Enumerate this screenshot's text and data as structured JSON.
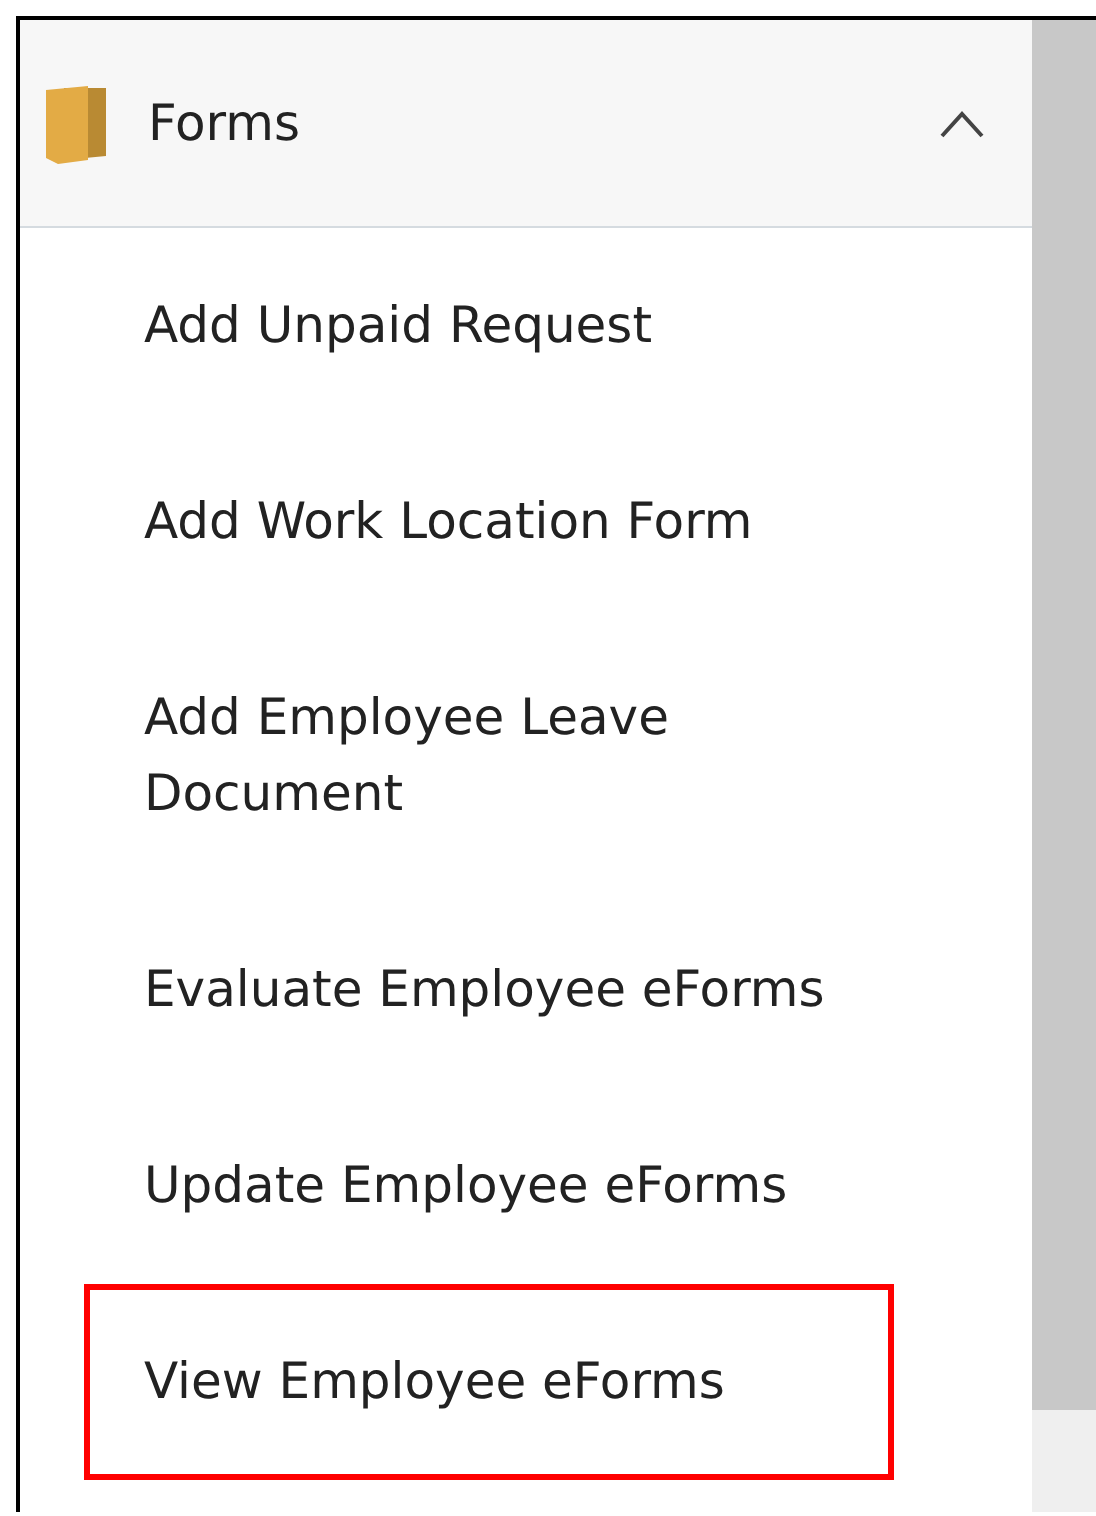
{
  "section": {
    "title": "Forms",
    "expanded": true
  },
  "items": [
    {
      "label": "Add Unpaid Request",
      "highlighted": false
    },
    {
      "label": "Add Work Location Form",
      "highlighted": false
    },
    {
      "label": "Add Employee Leave Document",
      "highlighted": false
    },
    {
      "label": "Evaluate Employee eForms",
      "highlighted": false
    },
    {
      "label": "Update Employee eForms",
      "highlighted": false
    },
    {
      "label": "View Employee eForms",
      "highlighted": true
    }
  ]
}
